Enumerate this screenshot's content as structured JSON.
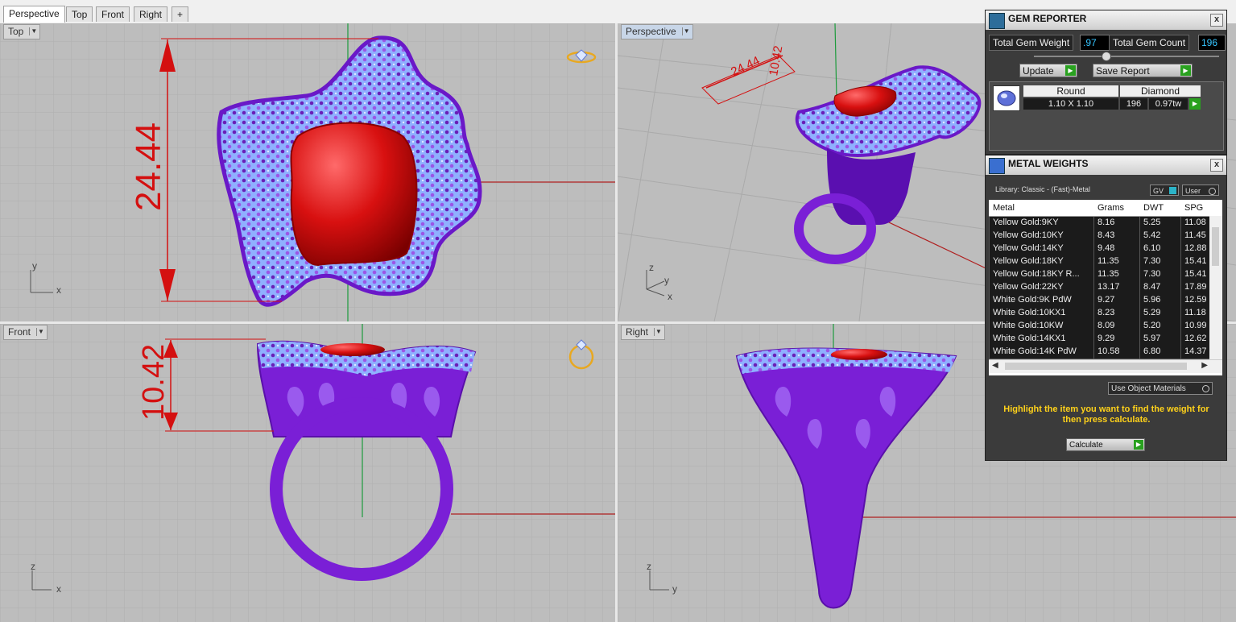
{
  "tabs": [
    {
      "label": "Perspective"
    },
    {
      "label": "Top"
    },
    {
      "label": "Front"
    },
    {
      "label": "Right"
    },
    {
      "label": "+"
    }
  ],
  "viewports": {
    "top": {
      "label": "Top",
      "dimension": "24.44",
      "axis_y": "y",
      "axis_x": "x"
    },
    "perspective": {
      "label": "Perspective",
      "dim_a": "24.44",
      "dim_b": "10.42",
      "axis_z": "z",
      "axis_y": "y",
      "axis_x": "x"
    },
    "front": {
      "label": "Front",
      "dimension": "10.42",
      "axis_z": "z",
      "axis_x": "x"
    },
    "right": {
      "label": "Right",
      "axis_z": "z",
      "axis_y": "y"
    }
  },
  "gem_reporter": {
    "title": "GEM REPORTER",
    "close": "x",
    "total_weight_label": "Total Gem Weight",
    "total_weight_value": ".97",
    "total_count_label": "Total Gem Count",
    "total_count_value": "196",
    "update_label": "Update",
    "save_report_label": "Save Report",
    "gem_table": {
      "headers": [
        "Round",
        "Diamond"
      ],
      "size": "1.10 X 1.10",
      "count": "196",
      "weight": "0.97tw"
    }
  },
  "metal_weights": {
    "title": "METAL WEIGHTS",
    "close": "x",
    "library": "Library: Classic - (Fast)-Metal",
    "gv_label": "GV",
    "user_label": "User",
    "columns": [
      "Metal",
      "Grams",
      "DWT",
      "SPG"
    ],
    "rows": [
      [
        "Yellow Gold:9KY",
        "8.16",
        "5.25",
        "11.08"
      ],
      [
        "Yellow Gold:10KY",
        "8.43",
        "5.42",
        "11.45"
      ],
      [
        "Yellow Gold:14KY",
        "9.48",
        "6.10",
        "12.88"
      ],
      [
        "Yellow Gold:18KY",
        "11.35",
        "7.30",
        "15.41"
      ],
      [
        "Yellow Gold:18KY R...",
        "11.35",
        "7.30",
        "15.41"
      ],
      [
        "Yellow Gold:22KY",
        "13.17",
        "8.47",
        "17.89"
      ],
      [
        "White Gold:9K PdW",
        "9.27",
        "5.96",
        "12.59"
      ],
      [
        "White Gold:10KX1",
        "8.23",
        "5.29",
        "11.18"
      ],
      [
        "White Gold:10KW",
        "8.09",
        "5.20",
        "10.99"
      ],
      [
        "White Gold:14KX1",
        "9.29",
        "5.97",
        "12.62"
      ],
      [
        "White Gold:14K PdW",
        "10.58",
        "6.80",
        "14.37"
      ]
    ],
    "use_object_materials": "Use Object Materials",
    "hint": "Highlight the item you want to find the weight for then press calculate.",
    "calculate_label": "Calculate"
  },
  "colors": {
    "accent_yellow": "#ffd21a",
    "ring_purple": "#7a1fd6",
    "gem_red": "#e01010",
    "pave_blue": "#8fb0ff",
    "value_cyan": "#36c5ff",
    "play_green": "#29a11f"
  },
  "icons": [
    "ring-view-icon",
    "gem-reporter-icon",
    "metal-weights-icon",
    "close-icon",
    "play-icon"
  ]
}
